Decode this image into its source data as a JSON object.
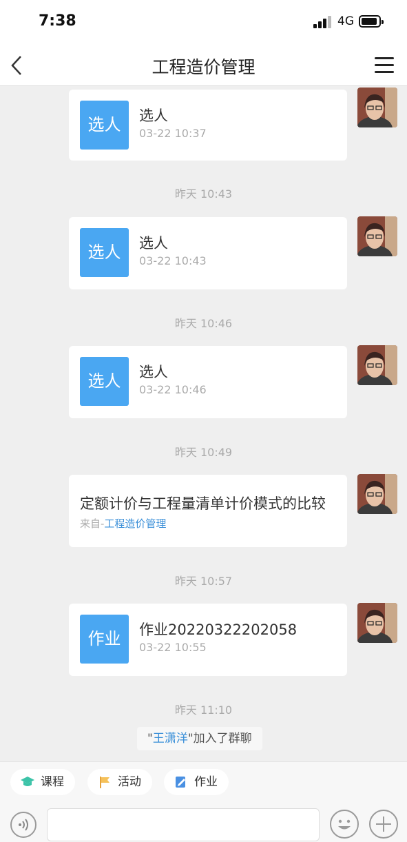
{
  "status_bar": {
    "time": "7:38",
    "network": "4G"
  },
  "header": {
    "title": "工程造价管理"
  },
  "messages": [
    {
      "icon_text": "选人",
      "title": "选人",
      "subtitle": "03-22 10:37"
    },
    {
      "timestamp": "昨天 10:43",
      "icon_text": "选人",
      "title": "选人",
      "subtitle": "03-22 10:43"
    },
    {
      "timestamp": "昨天 10:46",
      "icon_text": "选人",
      "title": "选人",
      "subtitle": "03-22 10:46"
    },
    {
      "timestamp": "昨天 10:49",
      "title": "定额计价与工程量清单计价模式的比较",
      "source_prefix": "来自-",
      "source_name": "工程造价管理"
    },
    {
      "timestamp": "昨天 10:57",
      "icon_text": "作业",
      "title": "作业20220322202058",
      "subtitle": "03-22 10:55"
    }
  ],
  "last_timestamp": "昨天 11:10",
  "system_notice": {
    "open_quote": "\"",
    "name": "王潇洋",
    "close_quote": "\"",
    "text": "加入了群聊"
  },
  "toolbar": {
    "chips": [
      "课程",
      "活动",
      "作业"
    ]
  },
  "input": {
    "value": ""
  },
  "colors": {
    "accent": "#4aa7f2",
    "link": "#3a8fd8"
  }
}
